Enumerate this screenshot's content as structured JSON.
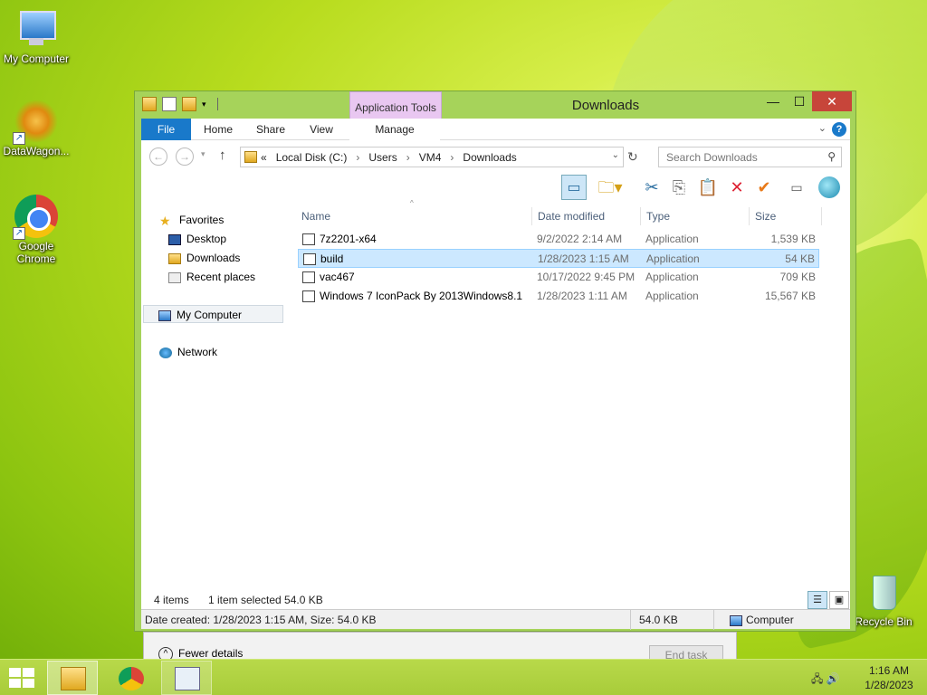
{
  "desktop": {
    "icons": [
      {
        "label": "My Computer"
      },
      {
        "label": "DataWagon..."
      },
      {
        "label": "Google Chrome"
      },
      {
        "label": "Recycle Bin"
      }
    ]
  },
  "taskmanager": {
    "fewer_details": "Fewer details",
    "end_task": "End task"
  },
  "window": {
    "title": "Downloads",
    "contextual_tab_group": "Application Tools",
    "buttons": {
      "minimize": "—",
      "maximize": "☐",
      "close": "✕"
    },
    "ribbon_tabs": [
      "File",
      "Home",
      "Share",
      "View",
      "Manage"
    ],
    "address": {
      "prefix": "«",
      "crumbs": [
        "Local Disk (C:)",
        "Users",
        "VM4",
        "Downloads"
      ]
    },
    "search_placeholder": "Search Downloads",
    "nav": {
      "favorites": "Favorites",
      "desktop": "Desktop",
      "downloads": "Downloads",
      "recent_places": "Recent places",
      "my_computer": "My Computer",
      "network": "Network"
    },
    "columns": {
      "name": "Name",
      "date": "Date modified",
      "type": "Type",
      "size": "Size"
    },
    "files": [
      {
        "name": "7z2201-x64",
        "date": "9/2/2022 2:14 AM",
        "type": "Application",
        "size": "1,539 KB",
        "selected": false
      },
      {
        "name": "build",
        "date": "1/28/2023 1:15 AM",
        "type": "Application",
        "size": "54 KB",
        "selected": true
      },
      {
        "name": "vac467",
        "date": "10/17/2022 9:45 PM",
        "type": "Application",
        "size": "709 KB",
        "selected": false
      },
      {
        "name": "Windows 7 IconPack By 2013Windows8.1",
        "date": "1/28/2023 1:11 AM",
        "type": "Application",
        "size": "15,567 KB",
        "selected": false
      }
    ],
    "status": {
      "item_count": "4 items",
      "selected": "1 item selected  54.0 KB",
      "details": "Date created: 1/28/2023 1:15 AM, Size: 54.0 KB",
      "size": "54.0 KB",
      "location": "Computer"
    }
  },
  "taskbar": {
    "time": "1:16 AM",
    "date": "1/28/2023"
  },
  "colors": {
    "accent": "#1979ca",
    "selection": "#cce8ff",
    "window_frame": "#a6d35a",
    "contextual_tab": "#e9c7f1",
    "close_button": "#c7453a"
  }
}
